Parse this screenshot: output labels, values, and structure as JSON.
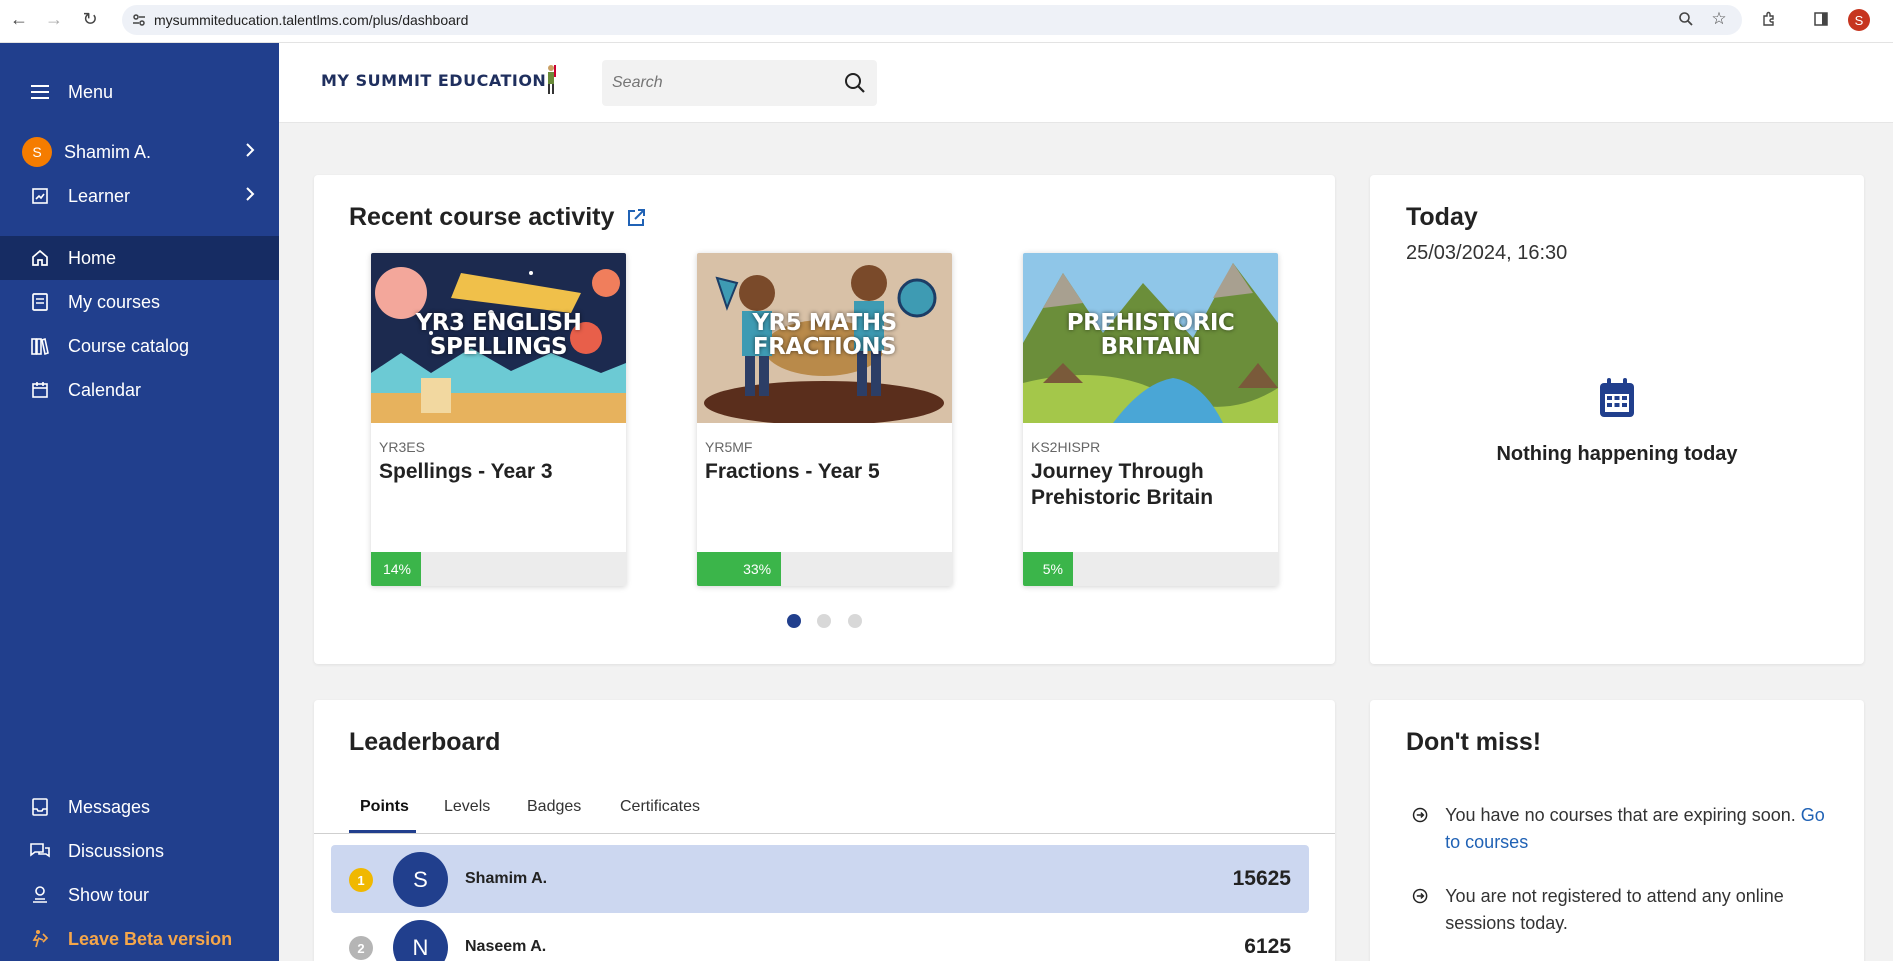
{
  "browser": {
    "url": "mysummiteducation.talentlms.com/plus/dashboard",
    "profile_initial": "S"
  },
  "sidebar": {
    "menu_label": "Menu",
    "user": {
      "initial": "S",
      "name": "Shamim A."
    },
    "role": "Learner",
    "items": [
      {
        "label": "Home",
        "icon": "home-icon",
        "active": true
      },
      {
        "label": "My courses",
        "icon": "book-icon"
      },
      {
        "label": "Course catalog",
        "icon": "library-icon"
      },
      {
        "label": "Calendar",
        "icon": "calendar-icon"
      }
    ],
    "bottom_items": [
      {
        "label": "Messages",
        "icon": "inbox-icon"
      },
      {
        "label": "Discussions",
        "icon": "chat-icon"
      },
      {
        "label": "Show tour",
        "icon": "tour-icon"
      },
      {
        "label": "Leave Beta version",
        "icon": "exit-beta-icon"
      }
    ]
  },
  "header": {
    "logo_text": "MY SUMMIT EDUCATION",
    "search_placeholder": "Search"
  },
  "recent_activity": {
    "title": "Recent course activity",
    "courses": [
      {
        "thumb_text_1": "YR3 ENGLISH",
        "thumb_text_2": "SPELLINGS",
        "code": "YR3ES",
        "name": "Spellings - Year 3",
        "progress": 14,
        "progress_label": "14%"
      },
      {
        "thumb_text_1": "YR5 MATHS",
        "thumb_text_2": "FRACTIONS",
        "code": "YR5MF",
        "name": "Fractions - Year 5",
        "progress": 33,
        "progress_label": "33%"
      },
      {
        "thumb_text_1": "PREHISTORIC",
        "thumb_text_2": "BRITAIN",
        "code": "KS2HISPR",
        "name": "Journey Through Prehistoric Britain",
        "progress": 5,
        "progress_label": "5%"
      }
    ],
    "pages": 3,
    "current_page": 1
  },
  "today": {
    "title": "Today",
    "datetime": "25/03/2024, 16:30",
    "empty_text": "Nothing happening today"
  },
  "leaderboard": {
    "title": "Leaderboard",
    "tabs": [
      "Points",
      "Levels",
      "Badges",
      "Certificates"
    ],
    "active_tab": "Points",
    "rows": [
      {
        "rank": "1",
        "initial": "S",
        "name": "Shamim A.",
        "points": "15625",
        "rank_color": "#f0b800"
      },
      {
        "rank": "2",
        "initial": "N",
        "name": "Naseem A.",
        "points": "6125",
        "rank_color": "#b5b5b5"
      }
    ]
  },
  "dont_miss": {
    "title": "Don't miss!",
    "item1_text": "You have no courses that are expiring soon.",
    "item1_link": "Go to courses",
    "item2_text": "You are not registered to attend any online sessions today."
  }
}
